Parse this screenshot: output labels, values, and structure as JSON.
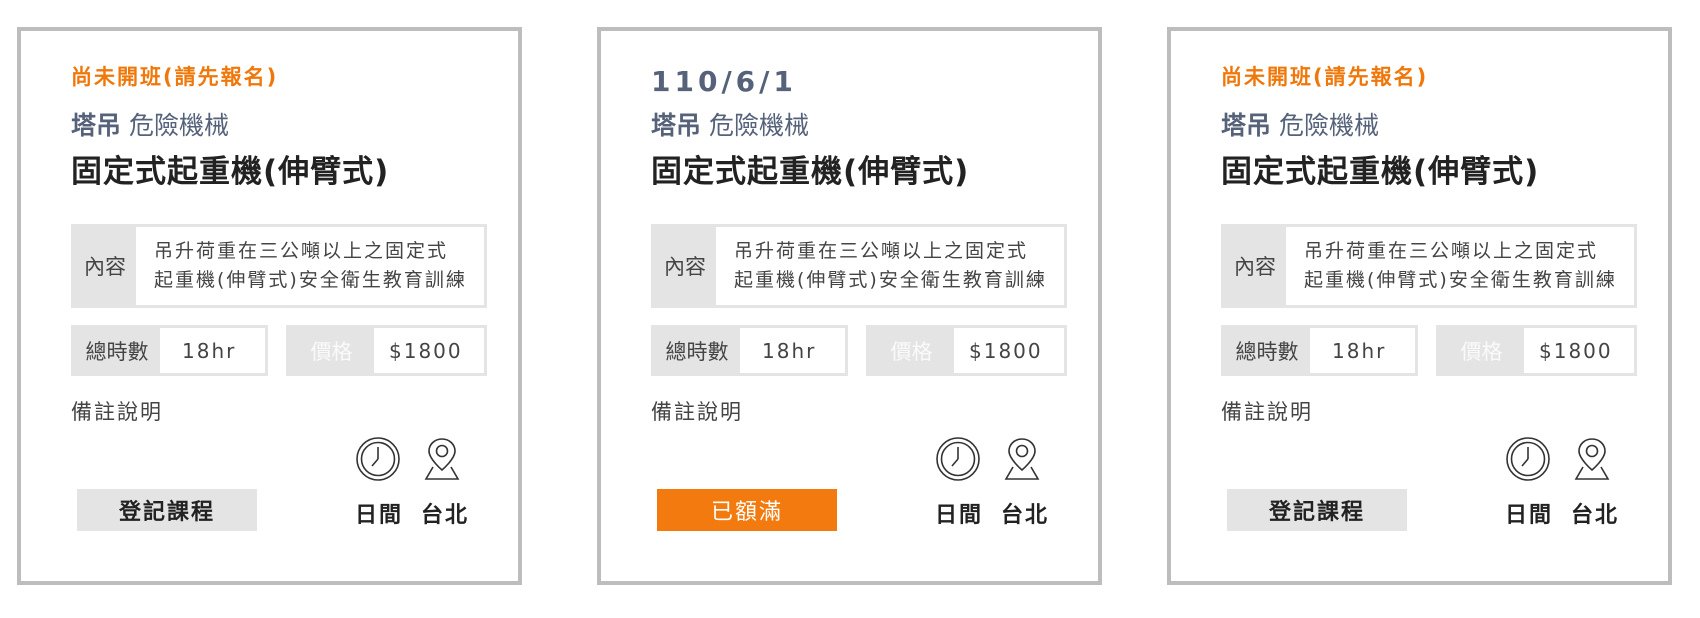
{
  "cards": [
    {
      "status": "尚未開班(請先報名)",
      "category_main": "塔吊",
      "category_sub": "危險機械",
      "title": "固定式起重機(伸臂式)",
      "content_label": "內容",
      "content_line1": "吊升荷重在三公噸以上之固定式",
      "content_line2": "起重機(伸臂式)安全衛生教育訓練",
      "hours_label": "總時數",
      "hours_value": "18hr",
      "price_label": "價格",
      "price_value": "$1800",
      "note": "備註說明",
      "button_label": "登記課程",
      "time_label": "日間",
      "location_label": "台北"
    },
    {
      "status": "110/6/1",
      "category_main": "塔吊",
      "category_sub": "危險機械",
      "title": "固定式起重機(伸臂式)",
      "content_label": "內容",
      "content_line1": "吊升荷重在三公噸以上之固定式",
      "content_line2": "起重機(伸臂式)安全衛生教育訓練",
      "hours_label": "總時數",
      "hours_value": "18hr",
      "price_label": "價格",
      "price_value": "$1800",
      "note": "備註說明",
      "button_label": "已額滿",
      "time_label": "日間",
      "location_label": "台北"
    },
    {
      "status": "尚未開班(請先報名)",
      "category_main": "塔吊",
      "category_sub": "危險機械",
      "title": "固定式起重機(伸臂式)",
      "content_label": "內容",
      "content_line1": "吊升荷重在三公噸以上之固定式",
      "content_line2": "起重機(伸臂式)安全衛生教育訓練",
      "hours_label": "總時數",
      "hours_value": "18hr",
      "price_label": "價格",
      "price_value": "$1800",
      "note": "備註說明",
      "button_label": "登記課程",
      "time_label": "日間",
      "location_label": "台北"
    }
  ],
  "colors": {
    "accent_orange": "#f37a0e",
    "status_orange": "#f0780a",
    "category_slate": "#55627a",
    "card_border": "#bdbdbd",
    "label_bg": "#e4e4e4"
  },
  "icons": {
    "time": "clock-icon",
    "location": "map-pin-icon"
  }
}
